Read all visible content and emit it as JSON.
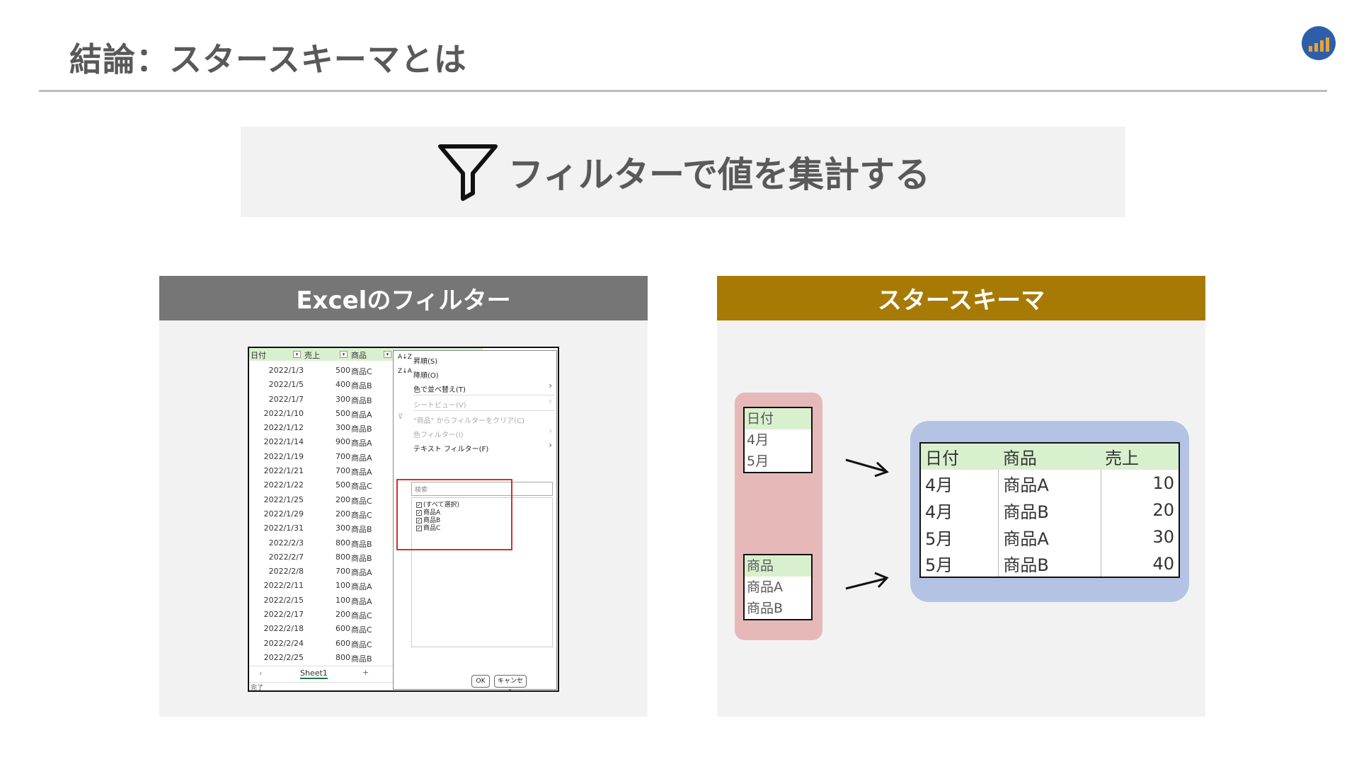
{
  "page": {
    "title": "結論：スタースキーマとは"
  },
  "banner": {
    "text": "フィルターで値を集計する"
  },
  "left_panel": {
    "header": "Excelのフィルター",
    "excel": {
      "columns": [
        "日付",
        "売上",
        "商品"
      ],
      "rows": [
        {
          "date": "2022/1/3",
          "sales": "500",
          "product": "商品C"
        },
        {
          "date": "2022/1/5",
          "sales": "400",
          "product": "商品B"
        },
        {
          "date": "2022/1/7",
          "sales": "300",
          "product": "商品B"
        },
        {
          "date": "2022/1/10",
          "sales": "500",
          "product": "商品A"
        },
        {
          "date": "2022/1/12",
          "sales": "300",
          "product": "商品B"
        },
        {
          "date": "2022/1/14",
          "sales": "900",
          "product": "商品A"
        },
        {
          "date": "2022/1/19",
          "sales": "700",
          "product": "商品A"
        },
        {
          "date": "2022/1/21",
          "sales": "700",
          "product": "商品A"
        },
        {
          "date": "2022/1/22",
          "sales": "500",
          "product": "商品C"
        },
        {
          "date": "2022/1/25",
          "sales": "200",
          "product": "商品C"
        },
        {
          "date": "2022/1/29",
          "sales": "200",
          "product": "商品C"
        },
        {
          "date": "2022/1/31",
          "sales": "300",
          "product": "商品B"
        },
        {
          "date": "2022/2/3",
          "sales": "800",
          "product": "商品B"
        },
        {
          "date": "2022/2/7",
          "sales": "800",
          "product": "商品B"
        },
        {
          "date": "2022/2/8",
          "sales": "700",
          "product": "商品A"
        },
        {
          "date": "2022/2/11",
          "sales": "100",
          "product": "商品A"
        },
        {
          "date": "2022/2/15",
          "sales": "100",
          "product": "商品A"
        },
        {
          "date": "2022/2/17",
          "sales": "200",
          "product": "商品C"
        },
        {
          "date": "2022/2/18",
          "sales": "600",
          "product": "商品C"
        },
        {
          "date": "2022/2/24",
          "sales": "600",
          "product": "商品C"
        },
        {
          "date": "2022/2/25",
          "sales": "800",
          "product": "商品B"
        }
      ],
      "sheet_tab": "Sheet1",
      "add_sheet": "+",
      "status": "完了",
      "menu": {
        "sort_asc": "昇順(S)",
        "sort_desc": "降順(O)",
        "sort_color": "色で並べ替え(T)",
        "sheet_view": "シートビュー(V)",
        "clear_filter": "\"商品\" からフィルターをクリア(C)",
        "color_filter": "色フィルター(I)",
        "text_filter": "テキスト フィルター(F)",
        "search_placeholder": "検索",
        "checklist": [
          "(すべて選択)",
          "商品A",
          "商品B",
          "商品C"
        ],
        "ok": "OK",
        "cancel": "キャンセル"
      }
    }
  },
  "right_panel": {
    "header": "スタースキーマ",
    "dim_date": {
      "header": "日付",
      "values": [
        "4月",
        "5月"
      ]
    },
    "dim_product": {
      "header": "商品",
      "values": [
        "商品A",
        "商品B"
      ]
    },
    "fact": {
      "headers": [
        "日付",
        "商品",
        "売上"
      ],
      "rows": [
        [
          "4月",
          "商品A",
          "10"
        ],
        [
          "4月",
          "商品B",
          "20"
        ],
        [
          "5月",
          "商品A",
          "30"
        ],
        [
          "5月",
          "商品B",
          "40"
        ]
      ]
    }
  },
  "colors": {
    "title": "#595959",
    "left_header": "#767676",
    "right_header": "#a77a05",
    "panel_bg": "#f2f2f2",
    "dim_bg": "#e6b9b8",
    "fact_bg": "#b4c3e4",
    "table_header": "#d9f0cf",
    "highlight": "#d32f2f"
  },
  "icons": {
    "banner": "filter-funnel-icon",
    "logo": "bar-chart-icon"
  }
}
